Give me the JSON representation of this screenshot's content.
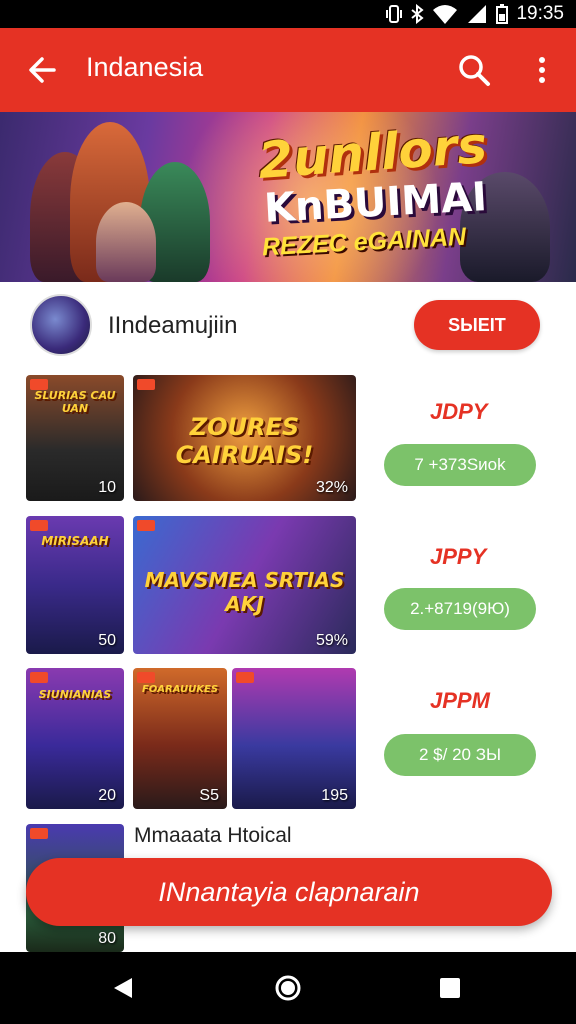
{
  "status_bar": {
    "time": "19:35",
    "icons": [
      "vibrate-icon",
      "bluetooth-icon",
      "wifi-icon",
      "signal-icon",
      "battery-icon"
    ]
  },
  "app_bar": {
    "title": "Indanesia",
    "actions": [
      "search-icon",
      "more-vert-icon"
    ],
    "color": "#e53224"
  },
  "banner": {
    "line1": "2unllors",
    "line2": "KnBUIMAI",
    "line3": "REZEC eGAINAN"
  },
  "channel": {
    "name": "IIndeamujiin",
    "button": "SЫEIT"
  },
  "rows": [
    {
      "thumbs": [
        {
          "caption": "SLURIAS CAU UAN",
          "count": "10"
        },
        {
          "caption": "ZOURES CAIRUAIS!",
          "count": "32%"
        }
      ],
      "price": "JDPY",
      "pill": "7 +373Sиok"
    },
    {
      "thumbs": [
        {
          "caption": "MIRISAAH",
          "count": "50"
        },
        {
          "caption": "MAVSMEA  SRTIAS AKJ",
          "count": "59%"
        }
      ],
      "price": "JPPY",
      "pill": "2.+8719(9Ю)"
    },
    {
      "thumbs": [
        {
          "caption": "SIUNIANIAS",
          "count": "20"
        },
        {
          "caption": "FOARAUUKES",
          "count": "S5"
        },
        {
          "caption": "",
          "count": "195"
        }
      ],
      "price": "JPPM",
      "pill": "2 $/ 20 ЗЫ"
    }
  ],
  "section_title": "Mmaaata Htoical",
  "last_thumb": {
    "caption": "",
    "count": "80"
  },
  "fab_label": "INnantayia clapnarain",
  "nav_bar": [
    "back-icon",
    "home-icon",
    "recents-icon"
  ]
}
